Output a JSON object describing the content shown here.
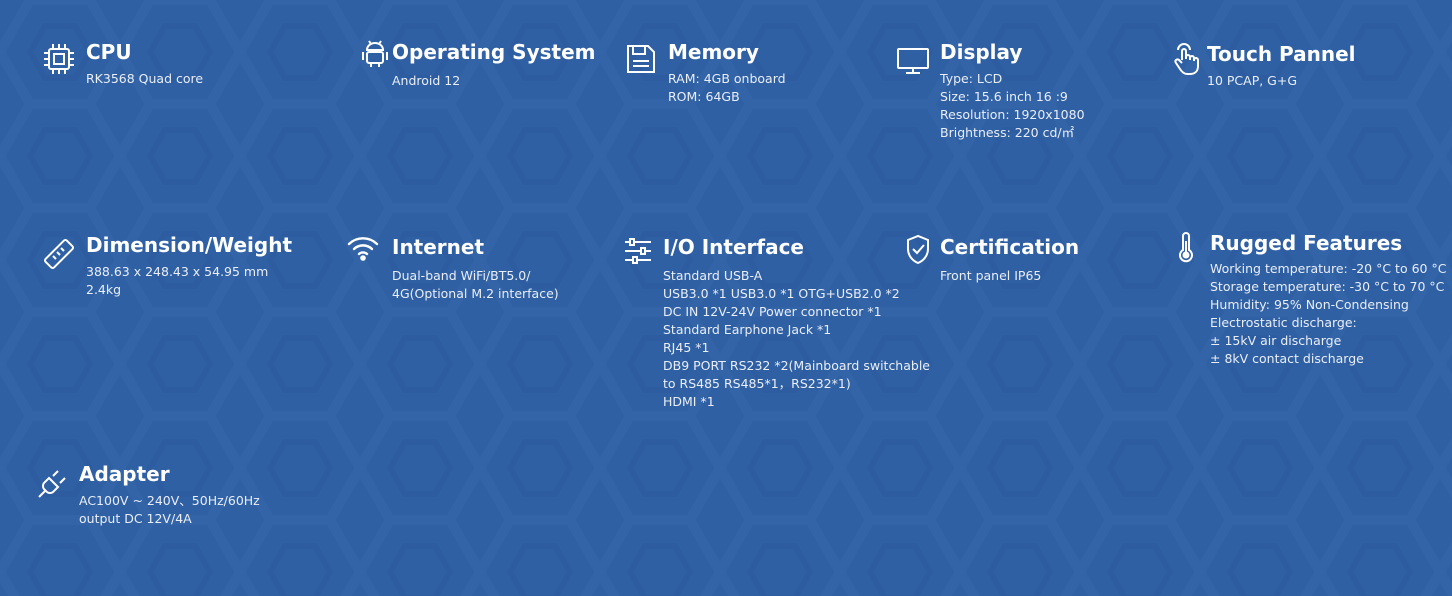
{
  "specs": [
    {
      "key": "cpu",
      "icon": "cpu-chip-icon",
      "title": "CPU",
      "lines": [
        "RK3568 Quad core"
      ]
    },
    {
      "key": "os",
      "icon": "android-icon",
      "title": "Operating System",
      "lines": [
        "Android 12"
      ]
    },
    {
      "key": "memory",
      "icon": "memory-card-icon",
      "title": "Memory",
      "lines": [
        "RAM: 4GB  onboard",
        "ROM: 64GB"
      ]
    },
    {
      "key": "display",
      "icon": "monitor-icon",
      "title": "Display",
      "lines": [
        "Type: LCD",
        "Size: 15.6 inch   16 :9",
        "Resolution:  1920x1080",
        "Brightness:  220 cd/㎡"
      ]
    },
    {
      "key": "touch",
      "icon": "touch-hand-icon",
      "title": "Touch Pannel",
      "lines": [
        "10 PCAP, G+G"
      ]
    },
    {
      "key": "dimension",
      "icon": "ruler-icon",
      "title": "Dimension/Weight",
      "lines": [
        "388.63 x 248.43 x 54.95 mm",
        "2.4kg"
      ]
    },
    {
      "key": "internet",
      "icon": "wifi-icon",
      "title": "Internet",
      "lines": [
        "Dual-band WiFi/BT5.0/",
        "4G(Optional M.2 interface)"
      ]
    },
    {
      "key": "io",
      "icon": "sliders-icon",
      "title": "I/O Interface",
      "lines": [
        "Standard USB-A",
        "USB3.0 *1   USB3.0 *1 OTG+USB2.0 *2",
        "DC IN 12V-24V  Power connector  *1",
        "Standard Earphone Jack  *1",
        "RJ45 *1",
        "DB9 PORT RS232 *2(Mainboard switchable",
        "to RS485 RS485*1，RS232*1)",
        "HDMI   *1"
      ]
    },
    {
      "key": "certification",
      "icon": "shield-check-icon",
      "title": "Certification",
      "lines": [
        "Front panel IP65"
      ]
    },
    {
      "key": "rugged",
      "icon": "thermometer-icon",
      "title": "Rugged Features",
      "lines": [
        "Working temperature: -20 °C to 60 °C",
        "Storage temperature: -30 °C to 70 °C",
        "Humidity: 95% Non-Condensing",
        "Electrostatic discharge:",
        "± 15kV air discharge",
        "± 8kV contact discharge"
      ]
    },
    {
      "key": "adapter",
      "icon": "plug-icon",
      "title": "Adapter",
      "lines": [
        "AC100V ~ 240V、50Hz/60Hz",
        "output DC 12V/4A"
      ]
    }
  ]
}
